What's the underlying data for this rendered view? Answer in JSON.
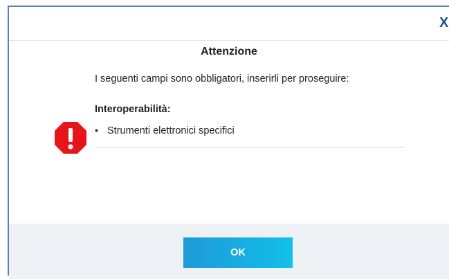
{
  "dialog": {
    "close_glyph": "X",
    "title": "Attenzione",
    "message": "I seguenti campi sono obbligatori, inserirli per proseguire:",
    "section_label": "Interoperabilità:",
    "items": [
      {
        "label": "Strumenti elettronici specifici"
      }
    ],
    "ok_label": "OK",
    "icon": "warning-octagon-icon",
    "colors": {
      "icon_fill": "#e8141c",
      "accent": "#1e9bd6",
      "border": "#5a7fb0",
      "close": "#1d4f86"
    }
  }
}
